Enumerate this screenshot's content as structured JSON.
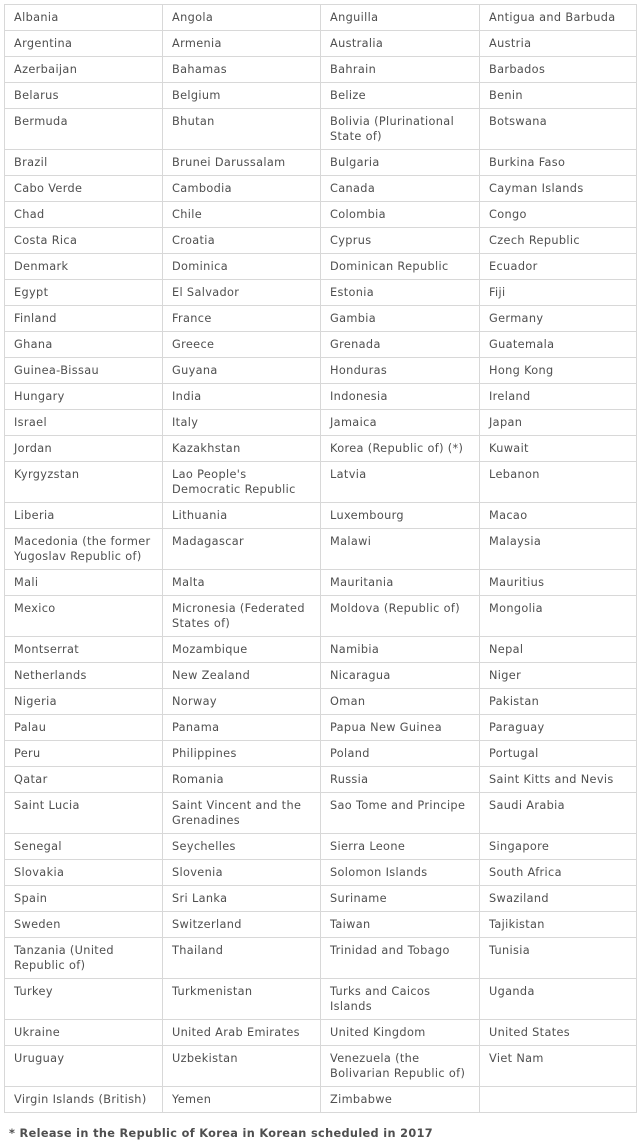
{
  "document": {
    "type": "country-list-table",
    "columns": 4,
    "footnote": "* Release in the Republic of Korea in Korean scheduled in 2017",
    "colors": {
      "text": "#4f4f4f",
      "border": "#d8d8d8",
      "background": "#ffffff"
    }
  },
  "table": {
    "rows": [
      {
        "tall": false,
        "cells": [
          "Albania",
          "Angola",
          "Anguilla",
          "Antigua and Barbuda"
        ]
      },
      {
        "tall": false,
        "cells": [
          "Argentina",
          "Armenia",
          "Australia",
          "Austria"
        ]
      },
      {
        "tall": false,
        "cells": [
          "Azerbaijan",
          "Bahamas",
          "Bahrain",
          "Barbados"
        ]
      },
      {
        "tall": false,
        "cells": [
          "Belarus",
          "Belgium",
          "Belize",
          "Benin"
        ]
      },
      {
        "tall": true,
        "cells": [
          "Bermuda",
          "Bhutan",
          "Bolivia (Plurinational State of)",
          "Botswana"
        ]
      },
      {
        "tall": false,
        "cells": [
          "Brazil",
          "Brunei Darussalam",
          "Bulgaria",
          "Burkina Faso"
        ]
      },
      {
        "tall": false,
        "cells": [
          "Cabo Verde",
          "Cambodia",
          "Canada",
          "Cayman Islands"
        ]
      },
      {
        "tall": false,
        "cells": [
          "Chad",
          "Chile",
          "Colombia",
          "Congo"
        ]
      },
      {
        "tall": false,
        "cells": [
          "Costa Rica",
          "Croatia",
          "Cyprus",
          "Czech Republic"
        ]
      },
      {
        "tall": false,
        "cells": [
          "Denmark",
          "Dominica",
          "Dominican Republic",
          "Ecuador"
        ]
      },
      {
        "tall": false,
        "cells": [
          "Egypt",
          "El Salvador",
          "Estonia",
          "Fiji"
        ]
      },
      {
        "tall": false,
        "cells": [
          "Finland",
          "France",
          "Gambia",
          "Germany"
        ]
      },
      {
        "tall": false,
        "cells": [
          "Ghana",
          "Greece",
          "Grenada",
          "Guatemala"
        ]
      },
      {
        "tall": false,
        "cells": [
          "Guinea-Bissau",
          "Guyana",
          "Honduras",
          "Hong Kong"
        ]
      },
      {
        "tall": false,
        "cells": [
          "Hungary",
          "India",
          "Indonesia",
          "Ireland"
        ]
      },
      {
        "tall": false,
        "cells": [
          "Israel",
          "Italy",
          "Jamaica",
          "Japan"
        ]
      },
      {
        "tall": false,
        "cells": [
          "Jordan",
          "Kazakhstan",
          "Korea (Republic of) (*)",
          "Kuwait"
        ]
      },
      {
        "tall": true,
        "cells": [
          "Kyrgyzstan",
          "Lao People's Democratic Republic",
          "Latvia",
          "Lebanon"
        ]
      },
      {
        "tall": false,
        "cells": [
          "Liberia",
          "Lithuania",
          "Luxembourg",
          "Macao"
        ]
      },
      {
        "tall": true,
        "cells": [
          "Macedonia (the former Yugoslav Republic of)",
          "Madagascar",
          "Malawi",
          "Malaysia"
        ]
      },
      {
        "tall": false,
        "cells": [
          "Mali",
          "Malta",
          "Mauritania",
          "Mauritius"
        ]
      },
      {
        "tall": true,
        "cells": [
          "Mexico",
          "Micronesia (Federated States of)",
          "Moldova (Republic of)",
          "Mongolia"
        ]
      },
      {
        "tall": false,
        "cells": [
          "Montserrat",
          "Mozambique",
          "Namibia",
          "Nepal"
        ]
      },
      {
        "tall": false,
        "cells": [
          "Netherlands",
          "New Zealand",
          "Nicaragua",
          "Niger"
        ]
      },
      {
        "tall": false,
        "cells": [
          "Nigeria",
          "Norway",
          "Oman",
          "Pakistan"
        ]
      },
      {
        "tall": false,
        "cells": [
          "Palau",
          "Panama",
          "Papua New Guinea",
          "Paraguay"
        ]
      },
      {
        "tall": false,
        "cells": [
          "Peru",
          "Philippines",
          "Poland",
          "Portugal"
        ]
      },
      {
        "tall": false,
        "cells": [
          "Qatar",
          "Romania",
          "Russia",
          "Saint Kitts and Nevis"
        ]
      },
      {
        "tall": true,
        "cells": [
          "Saint Lucia",
          "Saint Vincent and the Grenadines",
          "Sao Tome and Principe",
          "Saudi Arabia"
        ]
      },
      {
        "tall": false,
        "cells": [
          "Senegal",
          "Seychelles",
          "Sierra Leone",
          "Singapore"
        ]
      },
      {
        "tall": false,
        "cells": [
          "Slovakia",
          "Slovenia",
          "Solomon Islands",
          "South Africa"
        ]
      },
      {
        "tall": false,
        "cells": [
          "Spain",
          "Sri Lanka",
          "Suriname",
          "Swaziland"
        ]
      },
      {
        "tall": false,
        "cells": [
          "Sweden",
          "Switzerland",
          "Taiwan",
          "Tajikistan"
        ]
      },
      {
        "tall": true,
        "cells": [
          "Tanzania (United Republic of)",
          "Thailand",
          "Trinidad and Tobago",
          "Tunisia"
        ]
      },
      {
        "tall": true,
        "cells": [
          "Turkey",
          "Turkmenistan",
          "Turks and Caicos Islands",
          "Uganda"
        ]
      },
      {
        "tall": false,
        "cells": [
          "Ukraine",
          "United Arab Emirates",
          "United Kingdom",
          "United States"
        ]
      },
      {
        "tall": true,
        "cells": [
          "Uruguay",
          "Uzbekistan",
          "Venezuela (the Bolivarian Republic of)",
          "Viet Nam"
        ]
      },
      {
        "tall": false,
        "cells": [
          "Virgin Islands (British)",
          "Yemen",
          "Zimbabwe",
          ""
        ]
      }
    ]
  }
}
